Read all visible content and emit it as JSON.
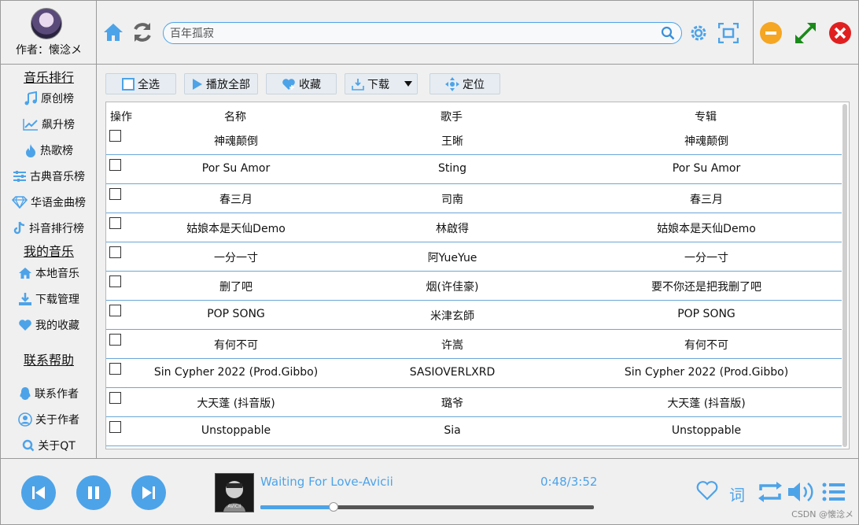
{
  "author": {
    "label": "作者：懐淰メ"
  },
  "search": {
    "placeholder": "百年孤寂"
  },
  "sidebar": {
    "section_rank": "音乐排行",
    "rank_items": [
      {
        "label": "原创榜",
        "icon": "music-note-icon"
      },
      {
        "label": "飙升榜",
        "icon": "trend-up-icon"
      },
      {
        "label": "热歌榜",
        "icon": "fire-icon"
      },
      {
        "label": "古典音乐榜",
        "icon": "sliders-icon"
      },
      {
        "label": "华语金曲榜",
        "icon": "diamond-icon"
      },
      {
        "label": "抖音排行榜",
        "icon": "tiktok-icon"
      }
    ],
    "section_my": "我的音乐",
    "my_items": [
      {
        "label": "本地音乐",
        "icon": "home-icon"
      },
      {
        "label": "下载管理",
        "icon": "download-icon"
      },
      {
        "label": "我的收藏",
        "icon": "heart-icon"
      }
    ],
    "section_help": "联系帮助",
    "help_items": [
      {
        "label": "联系作者",
        "icon": "qq-icon"
      },
      {
        "label": "关于作者",
        "icon": "user-icon"
      },
      {
        "label": "关于QT",
        "icon": "qt-icon"
      }
    ]
  },
  "actions": {
    "select_all": "全选",
    "play_all": "播放全部",
    "favorite": "收藏",
    "download": "下载",
    "locate": "定位"
  },
  "table": {
    "headers": [
      "操作",
      "名称",
      "歌手",
      "专辑"
    ],
    "rows": [
      {
        "name": "神魂颠倒",
        "artist": "王晰",
        "album": "神魂颠倒"
      },
      {
        "name": "Por Su Amor",
        "artist": "Sting",
        "album": "Por Su Amor"
      },
      {
        "name": "春三月",
        "artist": "司南",
        "album": "春三月"
      },
      {
        "name": "姑娘本是天仙Demo",
        "artist": "林啟得",
        "album": "姑娘本是天仙Demo"
      },
      {
        "name": "一分一寸",
        "artist": "阿YueYue",
        "album": "一分一寸"
      },
      {
        "name": "删了吧",
        "artist": "烟(许佳豪)",
        "album": "要不你还是把我删了吧"
      },
      {
        "name": "POP SONG",
        "artist": "米津玄師",
        "album": "POP SONG"
      },
      {
        "name": "有何不可",
        "artist": "许嵩",
        "album": "有何不可"
      },
      {
        "name": "Sin Cypher 2022 (Prod.Gibbo)",
        "artist": "SASIOVERLXRD",
        "album": "Sin Cypher 2022 (Prod.Gibbo)"
      },
      {
        "name": "大天蓬 (抖音版)",
        "artist": "璐爷",
        "album": "大天蓬 (抖音版)"
      },
      {
        "name": "Unstoppable",
        "artist": "Sia",
        "album": "Unstoppable"
      }
    ]
  },
  "player": {
    "title": "Waiting For Love-Avicii",
    "time": "0:48/3:52",
    "progress": 0.22,
    "lyrics_label": "词",
    "cover_text": "AVICII"
  },
  "watermark": "CSDN @懐淰メ",
  "colors": {
    "accent": "#4da3e8",
    "minimize": "#f5a623",
    "maximize": "#1a8a1a",
    "close": "#e02020"
  }
}
